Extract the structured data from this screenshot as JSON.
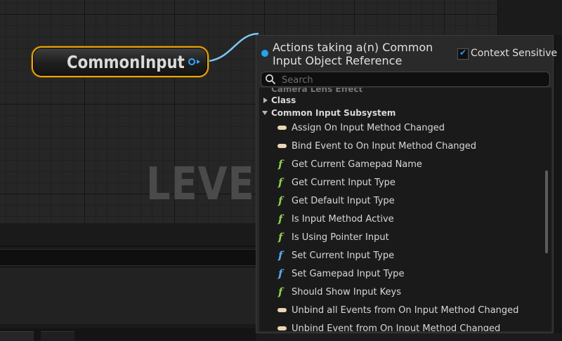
{
  "graph": {
    "watermark": "LEVEL",
    "node": {
      "title": "CommonInput",
      "pin_icon": "object-pin-icon",
      "wire_color": "#7ec6f5",
      "border_color": "#e8a515"
    }
  },
  "menu": {
    "title": "Actions taking a(n) Common Input Object Reference",
    "context_sensitive": {
      "label": "Context Sensitive",
      "checked": true
    },
    "search": {
      "placeholder": "Search",
      "value": ""
    },
    "cut_item": "Camera Lens Effect",
    "categories": [
      {
        "label": "Class",
        "expanded": false
      },
      {
        "label": "Common Input Subsystem",
        "expanded": true
      }
    ],
    "items": [
      {
        "label": "Assign On Input Method Changed",
        "icon": "event-icon"
      },
      {
        "label": "Bind Event to On Input Method Changed",
        "icon": "event-icon"
      },
      {
        "label": "Get Current Gamepad Name",
        "icon": "pure-function-icon"
      },
      {
        "label": "Get Current Input Type",
        "icon": "pure-function-icon"
      },
      {
        "label": "Get Default Input Type",
        "icon": "pure-function-icon"
      },
      {
        "label": "Is Input Method Active",
        "icon": "pure-function-icon"
      },
      {
        "label": "Is Using Pointer Input",
        "icon": "pure-function-icon"
      },
      {
        "label": "Set Current Input Type",
        "icon": "function-icon"
      },
      {
        "label": "Set Gamepad Input Type",
        "icon": "function-icon"
      },
      {
        "label": "Should Show Input Keys",
        "icon": "pure-function-icon"
      },
      {
        "label": "Unbind all Events from On Input Method Changed",
        "icon": "event-icon"
      },
      {
        "label": "Unbind Event from On Input Method Changed",
        "icon": "event-icon"
      }
    ],
    "colors": {
      "pure_function": "#8fd14f",
      "function": "#5aaeff",
      "event": "#ead6b4",
      "accent": "#1fa7f0"
    }
  }
}
